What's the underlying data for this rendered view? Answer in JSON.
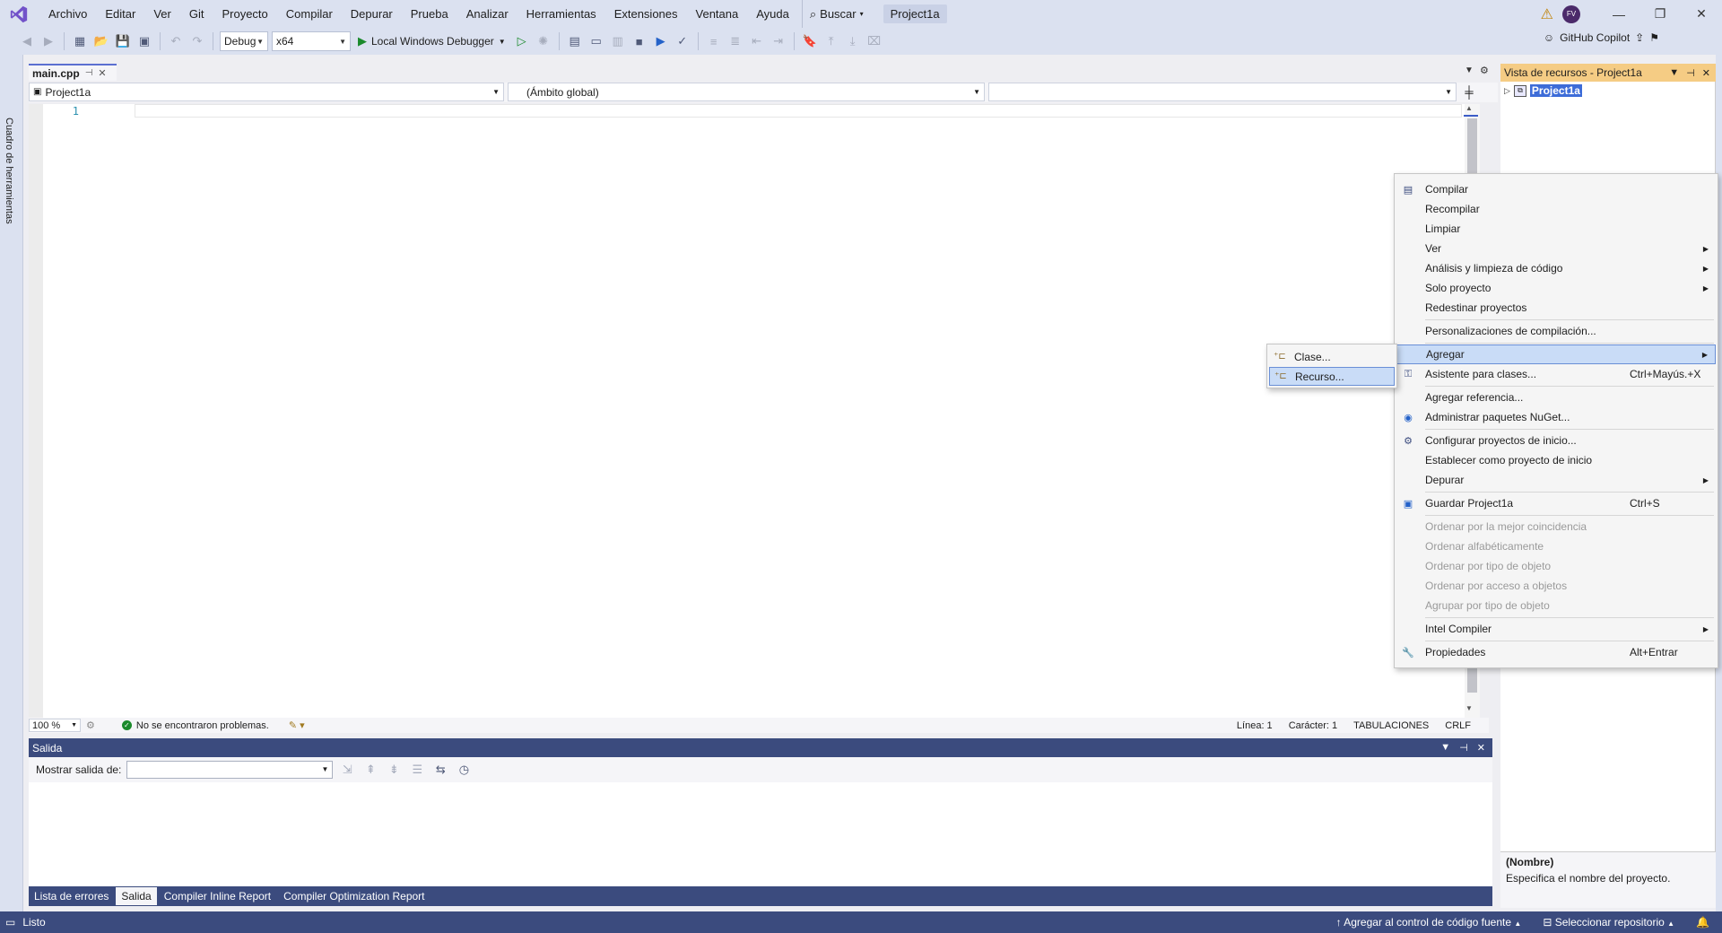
{
  "menubar": {
    "items": [
      "Archivo",
      "Editar",
      "Ver",
      "Git",
      "Proyecto",
      "Compilar",
      "Depurar",
      "Prueba",
      "Analizar",
      "Herramientas",
      "Extensiones",
      "Ventana",
      "Ayuda"
    ],
    "search_label": "Buscar",
    "project_title": "Project1a",
    "avatar_initials": "FV"
  },
  "toolbar": {
    "config": "Debug",
    "platform": "x64",
    "debugger": "Local Windows Debugger",
    "copilot": "GitHub Copilot"
  },
  "toolbox": {
    "label": "Cuadro de herramientas"
  },
  "editor": {
    "tab_name": "main.cpp",
    "nav_project": "Project1a",
    "nav_scope": "(Ámbito global)",
    "nav_member": "",
    "line_number": "1",
    "zoom": "100 %",
    "problems": "No se encontraron problemas.",
    "line": "Línea: 1",
    "char": "Carácter: 1",
    "indent": "TABULACIONES",
    "eol": "CRLF"
  },
  "output": {
    "title": "Salida",
    "show_from_label": "Mostrar salida de:",
    "show_from_value": ""
  },
  "bottom_tabs": [
    "Lista de errores",
    "Salida",
    "Compiler Inline Report",
    "Compiler Optimization Report"
  ],
  "resource_view": {
    "title": "Vista de recursos - Project1a",
    "root": "Project1a"
  },
  "properties": {
    "name": "(Nombre)",
    "description": "Especifica el nombre del proyecto."
  },
  "context_menu": {
    "items": [
      {
        "label": "Compilar",
        "icon": "build-icon"
      },
      {
        "label": "Recompilar"
      },
      {
        "label": "Limpiar"
      },
      {
        "label": "Ver",
        "submenu": true
      },
      {
        "label": "Análisis y limpieza de código",
        "submenu": true
      },
      {
        "label": "Solo proyecto",
        "submenu": true
      },
      {
        "label": "Redestinar proyectos"
      },
      {
        "label": "Personalizaciones de compilación..."
      },
      {
        "label": "Agregar",
        "submenu": true,
        "highlighted": true
      },
      {
        "label": "Asistente para clases...",
        "shortcut": "Ctrl+Mayús.+X",
        "icon": "class-wizard-icon"
      },
      {
        "label": "Agregar referencia..."
      },
      {
        "label": "Administrar paquetes NuGet...",
        "icon": "nuget-icon"
      },
      {
        "label": "Configurar proyectos de inicio...",
        "icon": "gear-icon"
      },
      {
        "label": "Establecer como proyecto de inicio"
      },
      {
        "label": "Depurar",
        "submenu": true
      },
      {
        "label": "Guardar Project1a",
        "shortcut": "Ctrl+S",
        "icon": "save-icon"
      },
      {
        "label": "Ordenar por la mejor coincidencia",
        "disabled": true
      },
      {
        "label": "Ordenar alfabéticamente",
        "disabled": true
      },
      {
        "label": "Ordenar por tipo de objeto",
        "disabled": true
      },
      {
        "label": "Ordenar por acceso a objetos",
        "disabled": true
      },
      {
        "label": "Agrupar por tipo de objeto",
        "disabled": true
      },
      {
        "label": "Intel Compiler",
        "submenu": true
      },
      {
        "label": "Propiedades",
        "shortcut": "Alt+Entrar",
        "icon": "wrench-icon"
      }
    ]
  },
  "submenu": {
    "items": [
      "Clase...",
      "Recurso..."
    ]
  },
  "statusbar": {
    "ready": "Listo",
    "source_control": "Agregar al control de código fuente",
    "repository": "Seleccionar repositorio"
  },
  "colors": {
    "accent": "#3b4b7e",
    "chrome": "#dbe1f0",
    "resource_view_title": "#f5cc84",
    "selection": "#3d6cd8"
  }
}
